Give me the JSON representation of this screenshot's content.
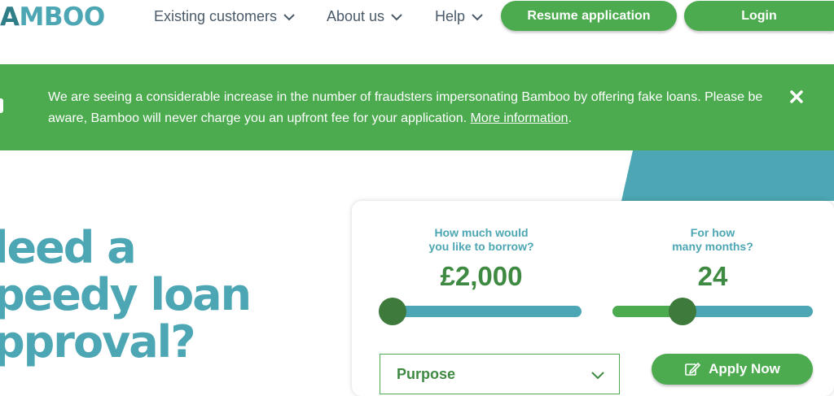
{
  "header": {
    "logo_text": "AMBOO",
    "nav": [
      {
        "label": "Existing customers",
        "icon": "chevron-down-icon"
      },
      {
        "label": "About us",
        "icon": "chevron-down-icon"
      },
      {
        "label": "Help",
        "icon": "chevron-down-icon"
      }
    ],
    "resume_label": "Resume application",
    "login_label": "Login"
  },
  "banner": {
    "text_line1": "We are seeing a considerable increase in the number of fraudsters impersonating Bamboo by offering fake loans. Please be",
    "text_line2_prefix": "aware, Bamboo will never charge you an upfront fee for your application. ",
    "link_text": "More information",
    "text_suffix": ".",
    "close_icon": "close-icon"
  },
  "hero": {
    "line1": "leed a",
    "line2": "peedy loan",
    "line3": "pproval?"
  },
  "calculator": {
    "amount": {
      "question_line1": "How much would",
      "question_line2": "you like to borrow?",
      "value": "£2,000",
      "slider_fraction": 0.05
    },
    "months": {
      "question_line1": "For how",
      "question_line2": "many months?",
      "value": "24",
      "slider_fraction": 0.35
    },
    "purpose_label": "Purpose",
    "apply_label": "Apply Now",
    "apply_icon": "edit-pencil-icon"
  },
  "colors": {
    "brand_green": "#4caa4f",
    "dark_green": "#3d7a3c",
    "teal": "#4ca6b3"
  }
}
